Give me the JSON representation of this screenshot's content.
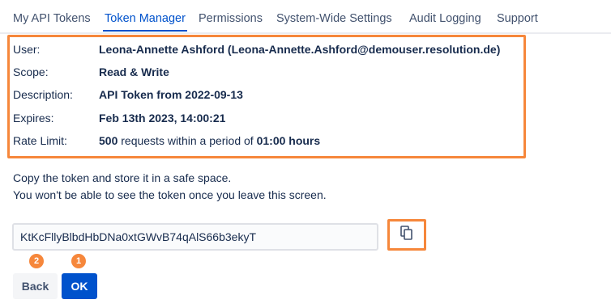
{
  "tabs": [
    {
      "label": "My API Tokens",
      "active": false
    },
    {
      "label": "Token Manager",
      "active": true
    },
    {
      "label": "Permissions",
      "active": false
    },
    {
      "label": "System-Wide Settings",
      "active": false
    },
    {
      "label": "Audit Logging",
      "active": false
    },
    {
      "label": "Support",
      "active": false
    }
  ],
  "details": {
    "user_label": "User:",
    "user_value": "Leona-Annette Ashford (Leona-Annette.Ashford@demouser.resolution.de)",
    "scope_label": "Scope:",
    "scope_value": "Read & Write",
    "description_label": "Description:",
    "description_value": "API Token from 2022-09-13",
    "expires_label": "Expires:",
    "expires_value": "Feb 13th 2023, 14:00:21",
    "rate_label": "Rate Limit:",
    "rate_count": "500",
    "rate_mid": " requests within a period of ",
    "rate_period": "01:00 hours"
  },
  "info": {
    "line1": "Copy the token and store it in a safe space.",
    "line2": "You won't be able to see the token once you leave this screen."
  },
  "token": {
    "value": "KtKcFllyBlbdHbDNa0xtGWvB74qAlS66b3ekyT"
  },
  "icons": {
    "copy": "copy-icon"
  },
  "badges": {
    "back": "2",
    "ok": "1"
  },
  "buttons": {
    "back_label": "Back",
    "ok_label": "OK"
  },
  "colors": {
    "accent": "#0052cc",
    "highlight": "#f6873b",
    "text": "#172b4d"
  }
}
